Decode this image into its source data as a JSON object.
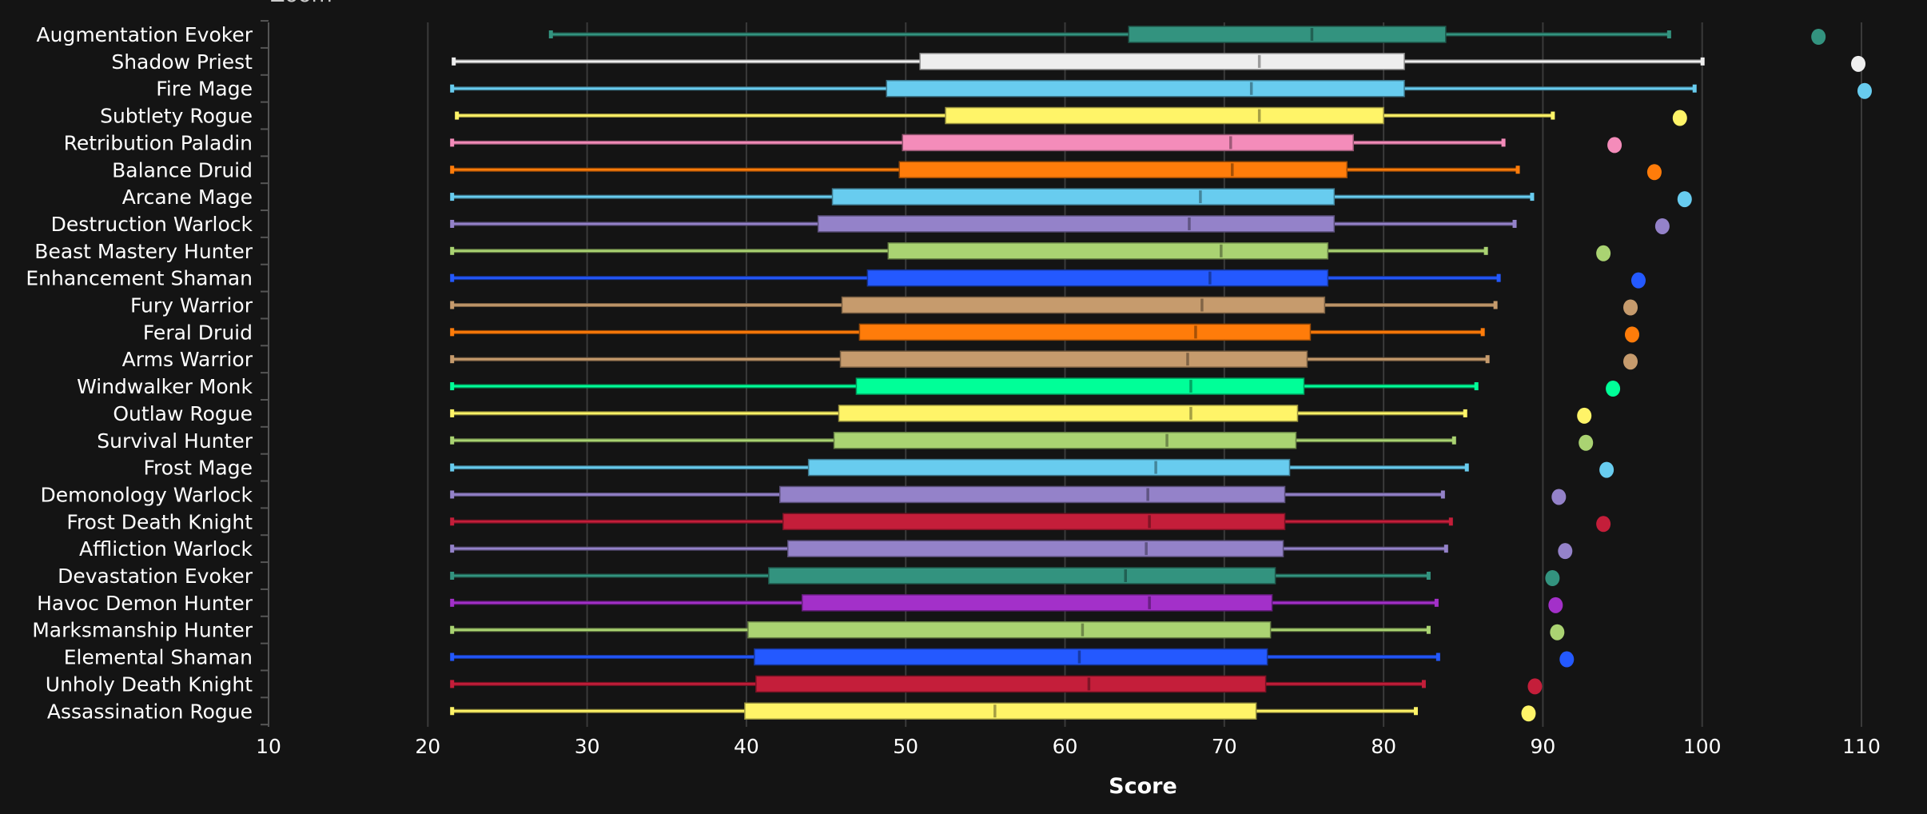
{
  "header": {
    "zoom_label": "Zoom"
  },
  "chart_data": {
    "type": "boxplot",
    "orientation": "horizontal",
    "title": "",
    "xlabel": "Score",
    "ylabel": "",
    "xlim": [
      10,
      112
    ],
    "xticks": [
      10,
      20,
      30,
      40,
      50,
      60,
      70,
      80,
      90,
      100,
      110
    ],
    "grid": true,
    "legend": "none",
    "series": [
      {
        "name": "Augmentation Evoker",
        "color": "#33937F",
        "whisker_low": 27.7,
        "q1": 64.0,
        "median": 75.5,
        "q3": 83.9,
        "whisker_high": 97.9,
        "max_point": 107.3
      },
      {
        "name": "Shadow Priest",
        "color": "#EEEEEE",
        "whisker_low": 21.6,
        "q1": 50.9,
        "median": 72.2,
        "q3": 81.3,
        "whisker_high": 100.0,
        "max_point": 109.8
      },
      {
        "name": "Fire Mage",
        "color": "#68CCEF",
        "whisker_low": 21.5,
        "q1": 48.8,
        "median": 71.7,
        "q3": 81.3,
        "whisker_high": 99.5,
        "max_point": 110.2
      },
      {
        "name": "Subtlety Rogue",
        "color": "#FFF468",
        "whisker_low": 21.8,
        "q1": 52.5,
        "median": 72.2,
        "q3": 80.0,
        "whisker_high": 90.6,
        "max_point": 98.6
      },
      {
        "name": "Retribution Paladin",
        "color": "#F48CBA",
        "whisker_low": 21.5,
        "q1": 49.8,
        "median": 70.4,
        "q3": 78.1,
        "whisker_high": 87.5,
        "max_point": 94.5
      },
      {
        "name": "Balance Druid",
        "color": "#FF7C0A",
        "whisker_low": 21.5,
        "q1": 49.6,
        "median": 70.5,
        "q3": 77.7,
        "whisker_high": 88.4,
        "max_point": 97.0
      },
      {
        "name": "Arcane Mage",
        "color": "#68CCEF",
        "whisker_low": 21.5,
        "q1": 45.4,
        "median": 68.5,
        "q3": 76.9,
        "whisker_high": 89.3,
        "max_point": 98.9
      },
      {
        "name": "Destruction Warlock",
        "color": "#9482C9",
        "whisker_low": 21.5,
        "q1": 44.5,
        "median": 67.8,
        "q3": 76.9,
        "whisker_high": 88.2,
        "max_point": 97.5
      },
      {
        "name": "Beast Mastery Hunter",
        "color": "#AAD372",
        "whisker_low": 21.5,
        "q1": 48.9,
        "median": 69.8,
        "q3": 76.5,
        "whisker_high": 86.4,
        "max_point": 93.8
      },
      {
        "name": "Enhancement Shaman",
        "color": "#2459FF",
        "whisker_low": 21.5,
        "q1": 47.6,
        "median": 69.1,
        "q3": 76.5,
        "whisker_high": 87.2,
        "max_point": 96.0
      },
      {
        "name": "Fury Warrior",
        "color": "#C69B6D",
        "whisker_low": 21.5,
        "q1": 46.0,
        "median": 68.6,
        "q3": 76.3,
        "whisker_high": 87.0,
        "max_point": 95.5
      },
      {
        "name": "Feral Druid",
        "color": "#FF7C0A",
        "whisker_low": 21.5,
        "q1": 47.1,
        "median": 68.2,
        "q3": 75.4,
        "whisker_high": 86.2,
        "max_point": 95.6
      },
      {
        "name": "Arms Warrior",
        "color": "#C69B6D",
        "whisker_low": 21.5,
        "q1": 45.9,
        "median": 67.7,
        "q3": 75.2,
        "whisker_high": 86.5,
        "max_point": 95.5
      },
      {
        "name": "Windwalker Monk",
        "color": "#00FF98",
        "whisker_low": 21.5,
        "q1": 46.9,
        "median": 67.9,
        "q3": 75.0,
        "whisker_high": 85.8,
        "max_point": 94.4
      },
      {
        "name": "Outlaw Rogue",
        "color": "#FFF468",
        "whisker_low": 21.5,
        "q1": 45.8,
        "median": 67.9,
        "q3": 74.6,
        "whisker_high": 85.1,
        "max_point": 92.6
      },
      {
        "name": "Survival Hunter",
        "color": "#AAD372",
        "whisker_low": 21.5,
        "q1": 45.5,
        "median": 66.4,
        "q3": 74.5,
        "whisker_high": 84.4,
        "max_point": 92.7
      },
      {
        "name": "Frost Mage",
        "color": "#68CCEF",
        "whisker_low": 21.5,
        "q1": 43.9,
        "median": 65.7,
        "q3": 74.1,
        "whisker_high": 85.2,
        "max_point": 94.0
      },
      {
        "name": "Demonology Warlock",
        "color": "#9482C9",
        "whisker_low": 21.5,
        "q1": 42.1,
        "median": 65.2,
        "q3": 73.8,
        "whisker_high": 83.7,
        "max_point": 91.0
      },
      {
        "name": "Frost Death Knight",
        "color": "#C41E3A",
        "whisker_low": 21.5,
        "q1": 42.3,
        "median": 65.3,
        "q3": 73.8,
        "whisker_high": 84.2,
        "max_point": 93.8
      },
      {
        "name": "Affliction Warlock",
        "color": "#9482C9",
        "whisker_low": 21.5,
        "q1": 42.6,
        "median": 65.1,
        "q3": 73.7,
        "whisker_high": 83.9,
        "max_point": 91.4
      },
      {
        "name": "Devastation Evoker",
        "color": "#33937F",
        "whisker_low": 21.5,
        "q1": 41.4,
        "median": 63.8,
        "q3": 73.2,
        "whisker_high": 82.8,
        "max_point": 90.6
      },
      {
        "name": "Havoc Demon Hunter",
        "color": "#A330C9",
        "whisker_low": 21.5,
        "q1": 43.5,
        "median": 65.3,
        "q3": 73.0,
        "whisker_high": 83.3,
        "max_point": 90.8
      },
      {
        "name": "Marksmanship Hunter",
        "color": "#AAD372",
        "whisker_low": 21.5,
        "q1": 40.1,
        "median": 61.1,
        "q3": 72.9,
        "whisker_high": 82.8,
        "max_point": 90.9
      },
      {
        "name": "Elemental Shaman",
        "color": "#2459FF",
        "whisker_low": 21.5,
        "q1": 40.5,
        "median": 60.9,
        "q3": 72.7,
        "whisker_high": 83.4,
        "max_point": 91.5
      },
      {
        "name": "Unholy Death Knight",
        "color": "#C41E3A",
        "whisker_low": 21.5,
        "q1": 40.6,
        "median": 61.5,
        "q3": 72.6,
        "whisker_high": 82.5,
        "max_point": 89.5
      },
      {
        "name": "Assassination Rogue",
        "color": "#FFF468",
        "whisker_low": 21.5,
        "q1": 39.9,
        "median": 55.6,
        "q3": 72.0,
        "whisker_high": 82.0,
        "max_point": 89.1
      }
    ]
  }
}
